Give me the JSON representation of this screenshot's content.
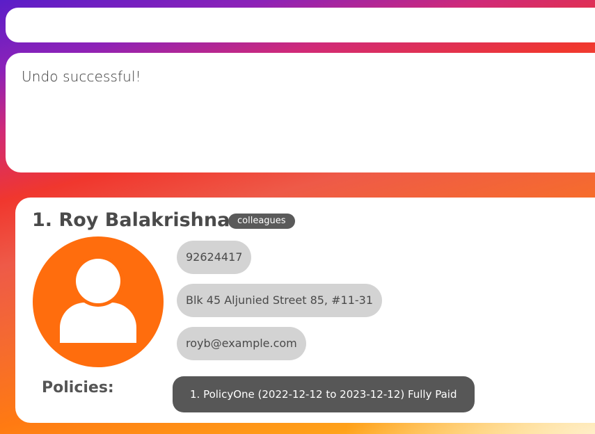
{
  "command_box": {
    "value": ""
  },
  "result_display": {
    "message": "Undo successful!"
  },
  "person_card": {
    "name": "1. Roy Balakrishnan",
    "tags": [
      "colleagues"
    ],
    "avatar_icon": "user-silhouette-icon",
    "avatar_color": "#ff6d0d",
    "phone": "92624417",
    "address": "Blk 45 Aljunied Street 85, #11-31",
    "email": "royb@example.com",
    "policies_label": "Policies:",
    "policies": [
      "1. PolicyOne (2022-12-12 to 2023-12-12) Fully Paid"
    ]
  }
}
